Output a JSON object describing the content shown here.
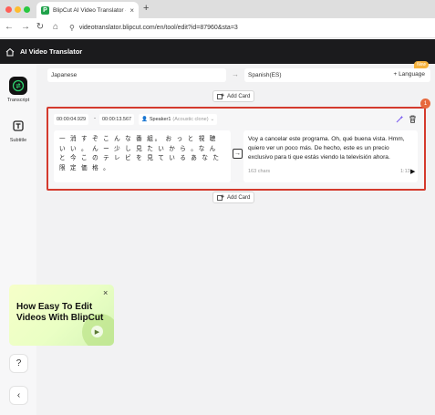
{
  "browser": {
    "tab_title": "BlipCut AI Video Translator - V",
    "new_tab": "+",
    "url": "videotranslator.blipcut.com/en/tool/edit?id=87960&sta=3"
  },
  "app": {
    "title": "AI Video Translator"
  },
  "sidebar": {
    "items": [
      {
        "label": "Transcript",
        "active": true
      },
      {
        "label": "Subtitle",
        "active": false
      }
    ],
    "help": "?",
    "collapse": "‹"
  },
  "languages": {
    "source": "Japanese",
    "target": "Spanish(ES)",
    "language_button": "+ Language",
    "new_badge": "New"
  },
  "add_card_label": "Add Card",
  "card": {
    "badge": "1",
    "start_time": "00:00:04.929",
    "separator": "-",
    "end_time": "00:00:13.567",
    "speaker": "Speaker1",
    "speaker_note": "(Acoustic clone)",
    "source_text": "一 消 す ぞ こ ん な 番 組。 お っ と 視 聴 い い 。 ん ー 少 し 見 た い か ら 。な ん と 今 こ の テ レ ビ を 見 て い る あ な た 限 定 価 格 。",
    "translated_text": "Voy a cancelar este programa. Oh, qué buena vista. Hmm, quiero ver un poco más. De hecho, este es un precio exclusivo para ti que estás viendo la televisión ahora.",
    "char_count": "163 chars",
    "duration": "1:13s"
  },
  "promo": {
    "title_line1": "How Easy To Edit",
    "title_line2": "Videos With BlipCut"
  },
  "colors": {
    "accent_green": "#2ed16f",
    "highlight_red": "#d43a2d",
    "badge_orange": "#e7693d",
    "new_badge": "#f5b23d"
  }
}
